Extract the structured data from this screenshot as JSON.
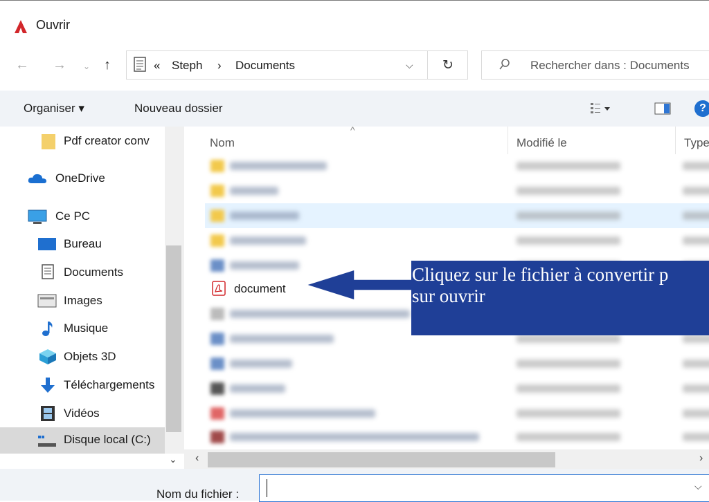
{
  "window": {
    "title": "Ouvrir"
  },
  "address": {
    "breadcrumb_prefix": "«",
    "path": [
      "Steph",
      "Documents"
    ],
    "separator": "›"
  },
  "search": {
    "placeholder": "Rechercher dans : Documents"
  },
  "toolbar": {
    "organize": "Organiser ▾",
    "new_folder": "Nouveau dossier"
  },
  "sidebar": {
    "items": [
      {
        "label": "Pdf creator conv",
        "icon": "folder-icon"
      },
      {
        "label": "OneDrive",
        "icon": "cloud-icon"
      },
      {
        "label": "Ce PC",
        "icon": "computer-icon"
      },
      {
        "label": "Bureau",
        "icon": "desktop-icon"
      },
      {
        "label": "Documents",
        "icon": "documents-icon"
      },
      {
        "label": "Images",
        "icon": "images-icon"
      },
      {
        "label": "Musique",
        "icon": "music-icon"
      },
      {
        "label": "Objets 3D",
        "icon": "cube-icon"
      },
      {
        "label": "Téléchargements",
        "icon": "download-icon"
      },
      {
        "label": "Vidéos",
        "icon": "video-icon"
      },
      {
        "label": "Disque local (C:)",
        "icon": "drive-icon"
      }
    ],
    "selected": "Disque local (C:)"
  },
  "list": {
    "columns": [
      "Nom",
      "Modifié le",
      "Type"
    ],
    "visible_file": {
      "name": "document",
      "icon": "pdf-icon"
    }
  },
  "bottom": {
    "filename_label": "Nom du fichier :",
    "filename_value": ""
  },
  "annotation": {
    "text_line1": "Cliquez sur le fichier à convertir p",
    "text_line2": "sur ouvrir"
  },
  "colors": {
    "callout_bg": "#1f3f97",
    "accent": "#2f76d4",
    "row_highlight": "#e5f3ff"
  }
}
